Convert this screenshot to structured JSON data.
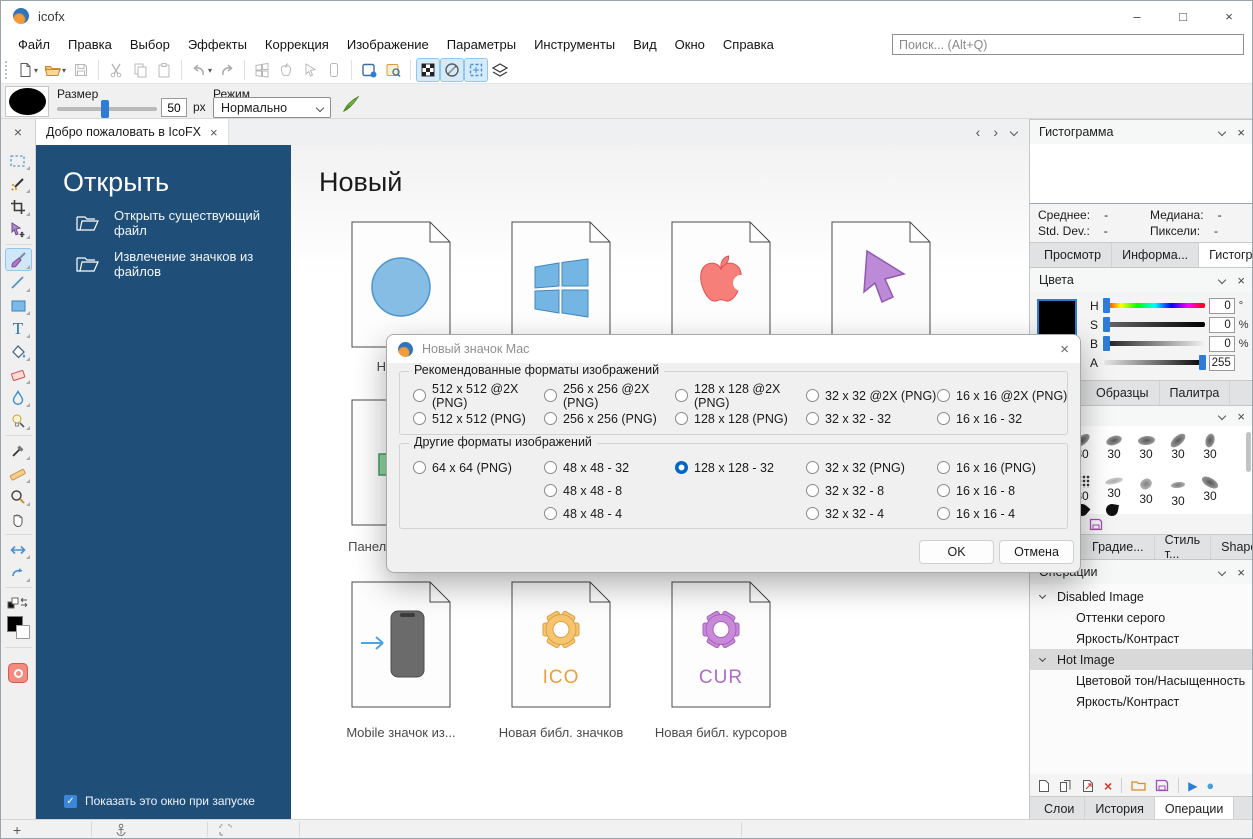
{
  "window": {
    "title": "icofx"
  },
  "icons": {
    "close": "×",
    "minimize": "–",
    "maximize": "□",
    "dropdown": "▾",
    "check": "✓",
    "play": "▶",
    "record": "●",
    "plus": "+",
    "back": "‹",
    "forward": "›"
  },
  "menubar": {
    "items": [
      "Файл",
      "Правка",
      "Выбор",
      "Эффекты",
      "Коррекция",
      "Изображение",
      "Параметры",
      "Инструменты",
      "Вид",
      "Окно",
      "Справка"
    ],
    "search_placeholder": "Поиск... (Alt+Q)"
  },
  "options": {
    "size_label": "Размер",
    "size_value": "50",
    "size_unit": "px",
    "mode_label": "Режим",
    "mode_value": "Нормально"
  },
  "tabbar": {
    "active_tab": "Добро пожаловать в IcoFX"
  },
  "welcome": {
    "open": {
      "title": "Открыть",
      "items": [
        "Открыть существующий файл",
        "Извлечение значков из файлов"
      ],
      "show_checkbox": "Показать это окно при запуске"
    },
    "new": {
      "title": "Новый",
      "labels": {
        "new_image": "Новое и",
        "panel": "Панель и",
        "mobile": "Mobile значок из...",
        "icon_lib": "Новая библ. значков",
        "cursor_lib": "Новая библ. курсоров"
      },
      "gear_ico": "ICO",
      "gear_cur": "CUR"
    }
  },
  "dialog": {
    "title": "Новый значок Mac",
    "recommended": {
      "title": "Рекомендованные форматы изображений",
      "options": [
        {
          "label": "512 x 512 @2X (PNG)"
        },
        {
          "label": "256 x 256 @2X (PNG)"
        },
        {
          "label": "128 x 128 @2X (PNG)"
        },
        {
          "label": "32 x 32 @2X (PNG)"
        },
        {
          "label": "16 x 16 @2X (PNG)"
        },
        {
          "label": "512 x 512 (PNG)"
        },
        {
          "label": "256 x 256 (PNG)"
        },
        {
          "label": "128 x 128 (PNG)"
        },
        {
          "label": "32 x 32 - 32"
        },
        {
          "label": "16 x 16 - 32"
        }
      ]
    },
    "other": {
      "title": "Другие форматы изображений",
      "options": [
        {
          "label": "64 x 64 (PNG)"
        },
        {
          "label": "48 x 48 - 32"
        },
        {
          "label": "128 x 128 - 32",
          "checked": true
        },
        {
          "label": "32 x 32 (PNG)"
        },
        {
          "label": "16 x 16 (PNG)"
        },
        {
          "label": ""
        },
        {
          "label": "48 x 48 - 8"
        },
        {
          "label": ""
        },
        {
          "label": "32 x 32 - 8"
        },
        {
          "label": "16 x 16 - 8"
        },
        {
          "label": ""
        },
        {
          "label": "48 x 48 - 4"
        },
        {
          "label": ""
        },
        {
          "label": "32 x 32 - 4"
        },
        {
          "label": "16 x 16 - 4"
        }
      ]
    },
    "ok": "OK",
    "cancel": "Отмена"
  },
  "panels": {
    "histogram": {
      "title": "Гистограмма",
      "stats": [
        {
          "label": "Среднее:",
          "value": "-"
        },
        {
          "label": "Медиана:",
          "value": "-"
        },
        {
          "label": "Std. Dev.:",
          "value": "-"
        },
        {
          "label": "Пиксели:",
          "value": "-"
        }
      ],
      "tabs": [
        {
          "label": "Просмотр"
        },
        {
          "label": "Информа..."
        },
        {
          "label": "Гистогра...",
          "active": true
        }
      ]
    },
    "colors": {
      "title": "Цвета",
      "sliders": [
        {
          "label": "H",
          "value": "0",
          "unit": "°",
          "cls": "sl-h"
        },
        {
          "label": "S",
          "value": "0",
          "unit": "%",
          "cls": "sl-s"
        },
        {
          "label": "B",
          "value": "0",
          "unit": "%",
          "cls": "sl-b"
        },
        {
          "label": "A",
          "value": "255",
          "unit": "",
          "cls": "sl-a"
        }
      ],
      "tabs": [
        {
          "label": "Образцы"
        },
        {
          "label": "Палитра"
        }
      ]
    },
    "brushes": {
      "items": [
        {
          "size": "30",
          "cls": "b1"
        },
        {
          "size": "30",
          "cls": "b2"
        },
        {
          "size": "30",
          "cls": "b3"
        },
        {
          "size": "30",
          "cls": "b4"
        },
        {
          "size": "30",
          "cls": "b5"
        },
        {
          "size": "30",
          "cls": "b6"
        },
        {
          "size": "30",
          "cls": "b7"
        },
        {
          "size": "30",
          "cls": "b8"
        },
        {
          "size": "30",
          "cls": "b9"
        },
        {
          "size": "30",
          "cls": "b10"
        }
      ],
      "tabs": [
        {
          "label": "Градие..."
        },
        {
          "label": "Стиль т..."
        },
        {
          "label": "Shapes"
        }
      ]
    },
    "operations": {
      "title": "Операции",
      "rows": [
        {
          "label": "Disabled Image",
          "cls": "parent"
        },
        {
          "label": "Оттенки серого",
          "cls": "child"
        },
        {
          "label": "Яркость/Контраст",
          "cls": "child"
        },
        {
          "label": "Hot Image",
          "cls": "parent selected"
        },
        {
          "label": "Цветовой тон/Насыщенность",
          "cls": "child"
        },
        {
          "label": "Яркость/Контраст",
          "cls": "child"
        }
      ],
      "tabs": [
        {
          "label": "Слои"
        },
        {
          "label": "История"
        },
        {
          "label": "Операции",
          "active": true
        }
      ]
    }
  }
}
